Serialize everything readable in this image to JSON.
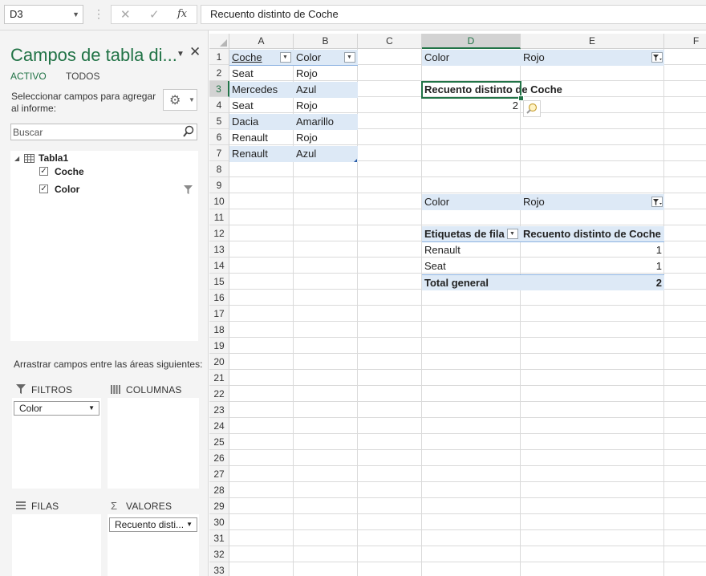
{
  "formula_bar": {
    "name_box": "D3",
    "separator": "⋮",
    "cancel_glyph": "✕",
    "confirm_glyph": "✓",
    "fx_label": "fx",
    "formula": "Recuento distinto de Coche"
  },
  "pane": {
    "title": "Campos de tabla di...",
    "tabs": [
      "ACTIVO",
      "TODOS"
    ],
    "instructions": "Seleccionar campos para agregar al informe:",
    "search_placeholder": "Buscar",
    "table_name": "Tabla1",
    "fields": [
      {
        "label": "Coche",
        "checked": true,
        "filtered": false
      },
      {
        "label": "Color",
        "checked": true,
        "filtered": true
      }
    ],
    "drag_label": "Arrastrar campos entre las áreas siguientes:",
    "areas": {
      "filters": {
        "label": "FILTROS",
        "items": [
          "Color"
        ]
      },
      "columns": {
        "label": "COLUMNAS",
        "items": []
      },
      "rows": {
        "label": "FILAS",
        "items": []
      },
      "values": {
        "label": "VALORES",
        "items": [
          "Recuento disti..."
        ]
      }
    }
  },
  "grid": {
    "columns": [
      "A",
      "B",
      "C",
      "D",
      "E",
      "F"
    ],
    "selected_column": "D",
    "rows": [
      1,
      2,
      3,
      4,
      5,
      6,
      7,
      8,
      9,
      10,
      11,
      12,
      13,
      14,
      15,
      16,
      17,
      18,
      19,
      20,
      21,
      22,
      23,
      24,
      25,
      26,
      27,
      28,
      29,
      30,
      31,
      32,
      33
    ],
    "selected_row": 3,
    "table": {
      "headers": [
        "Coche",
        "Color"
      ],
      "rows": [
        [
          "Seat",
          "Rojo"
        ],
        [
          "Mercedes",
          "Azul"
        ],
        [
          "Seat",
          "Rojo"
        ],
        [
          "Dacia",
          "Amarillo"
        ],
        [
          "Renault",
          "Rojo"
        ],
        [
          "Renault",
          "Azul"
        ]
      ]
    },
    "pivot1": {
      "filter_field": "Color",
      "filter_value": "Rojo",
      "value_header": "Recuento distinto de Coche",
      "value": "2"
    },
    "pivot2": {
      "filter_field": "Color",
      "filter_value": "Rojo",
      "row_header": "Etiquetas de fila",
      "value_header": "Recuento distinto de Coche",
      "rows": [
        {
          "label": "Renault",
          "value": "1"
        },
        {
          "label": "Seat",
          "value": "1"
        }
      ],
      "total_label": "Total general",
      "total_value": "2"
    }
  },
  "colors": {
    "accent_green": "#217346",
    "table_band": "#dde9f6",
    "table_header_line": "#8db3e2"
  }
}
